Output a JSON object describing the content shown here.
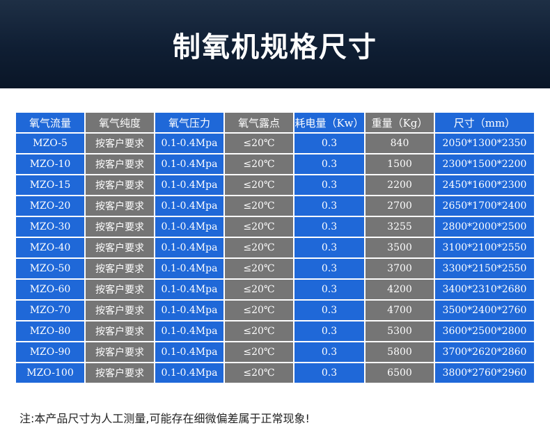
{
  "title": "制氧机规格尺寸",
  "table": {
    "headers": [
      "氧气流量",
      "氧气纯度",
      "氧气压力",
      "氧气露点",
      "耗电量（Kw）",
      "重量（Kg）",
      "尺寸（mm）"
    ],
    "rows": [
      [
        "MZO-5",
        "按客户要求",
        "0.1-0.4Mpa",
        "≤20℃",
        "0.3",
        "840",
        "2050*1300*2350"
      ],
      [
        "MZO-10",
        "按客户要求",
        "0.1-0.4Mpa",
        "≤20℃",
        "0.3",
        "1500",
        "2300*1500*2200"
      ],
      [
        "MZO-15",
        "按客户要求",
        "0.1-0.4Mpa",
        "≤20℃",
        "0.3",
        "2200",
        "2450*1600*2300"
      ],
      [
        "MZO-20",
        "按客户要求",
        "0.1-0.4Mpa",
        "≤20℃",
        "0.3",
        "2700",
        "2650*1700*2400"
      ],
      [
        "MZO-30",
        "按客户要求",
        "0.1-0.4Mpa",
        "≤20℃",
        "0.3",
        "3255",
        "2800*2000*2500"
      ],
      [
        "MZO-40",
        "按客户要求",
        "0.1-0.4Mpa",
        "≤20℃",
        "0.3",
        "3500",
        "3100*2100*2550"
      ],
      [
        "MZO-50",
        "按客户要求",
        "0.1-0.4Mpa",
        "≤20℃",
        "0.3",
        "3700",
        "3300*2150*2550"
      ],
      [
        "MZO-60",
        "按客户要求",
        "0.1-0.4Mpa",
        "≤20℃",
        "0.3",
        "4200",
        "3400*2310*2680"
      ],
      [
        "MZO-70",
        "按客户要求",
        "0.1-0.4Mpa",
        "≤20℃",
        "0.3",
        "4700",
        "3500*2400*2760"
      ],
      [
        "MZO-80",
        "按客户要求",
        "0.1-0.4Mpa",
        "≤20℃",
        "0.3",
        "5300",
        "3600*2500*2800"
      ],
      [
        "MZO-90",
        "按客户要求",
        "0.1-0.4Mpa",
        "≤20℃",
        "0.3",
        "5800",
        "3700*2620*2860"
      ],
      [
        "MZO-100",
        "按客户要求",
        "0.1-0.4Mpa",
        "≤20℃",
        "0.3",
        "6500",
        "3800*2760*2960"
      ]
    ]
  },
  "note": "注:本产品尺寸为人工测量,可能存在细微偏差属于正常现象!",
  "colors": {
    "banner": "#0f1e33",
    "cell_blue": "#1f68d8",
    "cell_gray": "#757575",
    "text": "#ffffff"
  }
}
